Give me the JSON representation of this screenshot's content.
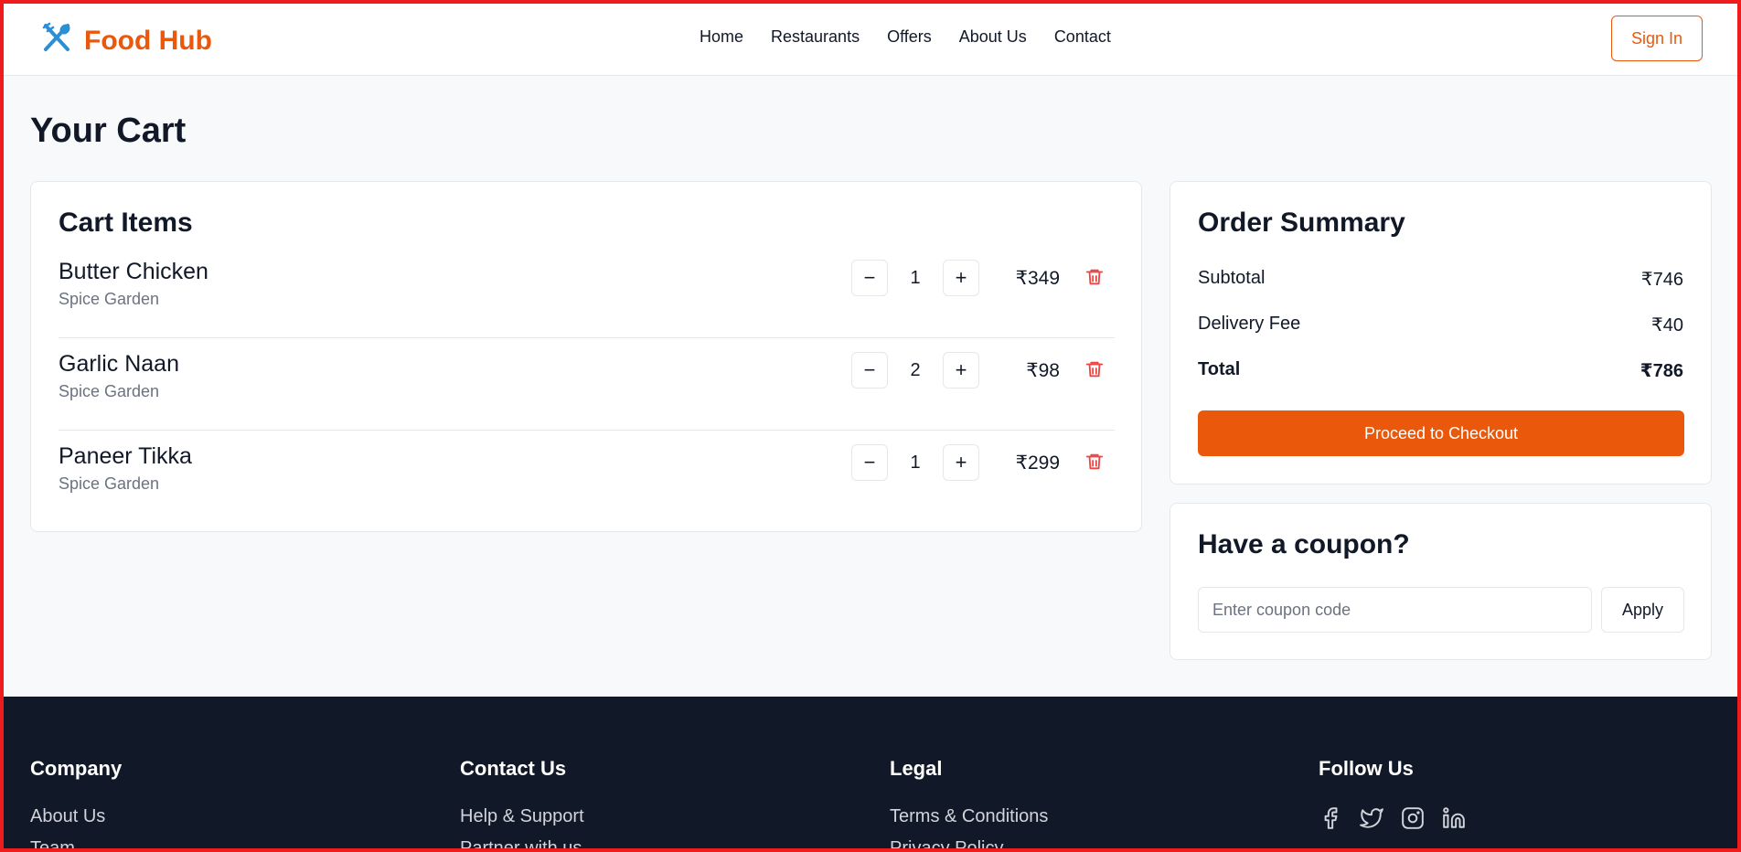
{
  "brand": {
    "name": "Food Hub",
    "accent": "#ea580c"
  },
  "nav": {
    "items": [
      "Home",
      "Restaurants",
      "Offers",
      "About Us",
      "Contact"
    ]
  },
  "header": {
    "sign_in": "Sign In"
  },
  "page": {
    "title": "Your Cart"
  },
  "cart": {
    "title": "Cart Items",
    "items": [
      {
        "name": "Butter Chicken",
        "restaurant": "Spice Garden",
        "qty": "1",
        "price": "₹349"
      },
      {
        "name": "Garlic Naan",
        "restaurant": "Spice Garden",
        "qty": "2",
        "price": "₹98"
      },
      {
        "name": "Paneer Tikka",
        "restaurant": "Spice Garden",
        "qty": "1",
        "price": "₹299"
      }
    ],
    "minus_label": "−",
    "plus_label": "+"
  },
  "summary": {
    "title": "Order Summary",
    "subtotal_label": "Subtotal",
    "subtotal": "₹746",
    "delivery_label": "Delivery Fee",
    "delivery": "₹40",
    "total_label": "Total",
    "total": "₹786",
    "checkout": "Proceed to Checkout"
  },
  "coupon": {
    "title": "Have a coupon?",
    "placeholder": "Enter coupon code",
    "apply": "Apply"
  },
  "footer": {
    "company": {
      "title": "Company",
      "links": [
        "About Us",
        "Team"
      ]
    },
    "contact": {
      "title": "Contact Us",
      "links": [
        "Help & Support",
        "Partner with us"
      ]
    },
    "legal": {
      "title": "Legal",
      "links": [
        "Terms & Conditions",
        "Privacy Policy"
      ]
    },
    "follow": {
      "title": "Follow Us",
      "icons": [
        "facebook-icon",
        "twitter-icon",
        "instagram-icon",
        "linkedin-icon"
      ]
    }
  },
  "colors": {
    "delete": "#ef4444",
    "footer_bg": "#111827",
    "frame": "#ee1c1c"
  }
}
